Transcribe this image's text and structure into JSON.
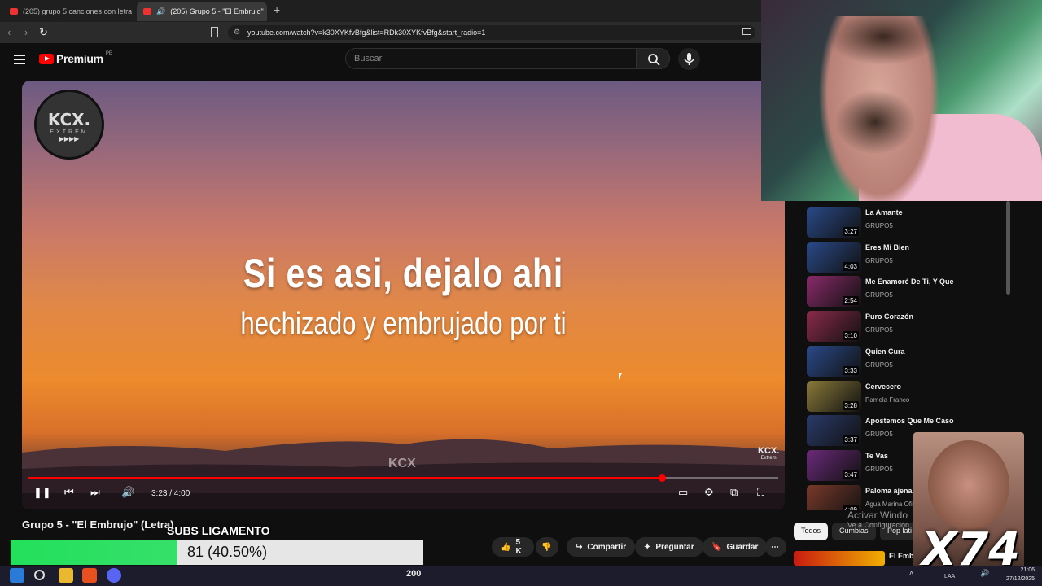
{
  "browser": {
    "tabs": [
      {
        "label": "(205) grupo 5 canciones con letra - Y"
      },
      {
        "label": "(205) Grupo 5 - \"El Embrujo\"",
        "active": true
      }
    ],
    "url": "youtube.com/watch?v=k30XYKfvBfg&list=RDk30XYKfvBfg&start_radio=1"
  },
  "youtube": {
    "logo": "Premium",
    "logo_region": "PE",
    "search_placeholder": "Buscar"
  },
  "player": {
    "lyric_line1": "Si es asi, dejalo ahi",
    "lyric_line2": "hechizado y embrujado por ti",
    "channel_logo_text": "KCX.",
    "channel_logo_sub": "EXTREM",
    "channel_logo_dots": "▶▶▶▶",
    "watermark": "KCX.",
    "watermark_sub": "Extrem",
    "center_watermark": "KCX",
    "time": "3:23 / 4:00",
    "progress": 0.845
  },
  "video": {
    "title": "Grupo 5 - \"El Embrujo\" (Letra)",
    "likes": "5 K",
    "share_label": "Compartir",
    "ask_label": "Preguntar",
    "save_label": "Guardar"
  },
  "sidebar": {
    "items": [
      {
        "title": "La Amante",
        "channel": "GRUPO5",
        "duration": "3:27",
        "thumb_color": "#2a4a8a"
      },
      {
        "title": "Eres Mi Bien",
        "channel": "GRUPO5",
        "duration": "4:03",
        "thumb_color": "#2a4a8a"
      },
      {
        "title": "Me Enamoré De Ti, Y Que",
        "channel": "GRUPO5",
        "duration": "2:54",
        "thumb_color": "#8a2a6a"
      },
      {
        "title": "Puro Corazón",
        "channel": "GRUPO5",
        "duration": "3:10",
        "thumb_color": "#8a2a4a"
      },
      {
        "title": "Quien Cura",
        "channel": "GRUPO5",
        "duration": "3:33",
        "thumb_color": "#2a4a8a"
      },
      {
        "title": "Cervecero",
        "channel": "Pamela Franco",
        "duration": "3:28",
        "thumb_color": "#8a7a3a"
      },
      {
        "title": "Apostemos Que Me Caso",
        "channel": "GRUPO5",
        "duration": "3:37",
        "thumb_color": "#2a3a6a"
      },
      {
        "title": "Te Vas",
        "channel": "GRUPO5",
        "duration": "3:47",
        "thumb_color": "#6a2a7a"
      },
      {
        "title": "Paloma ajena",
        "channel": "Agua Marina Ofi",
        "duration": "4:09",
        "thumb_color": "#7a3a2a"
      }
    ],
    "chips": [
      "Todos",
      "Cumbias",
      "Pop lati"
    ],
    "next_title": "El Embrujo"
  },
  "overlay": {
    "subs_label": "SUBS LIGAMENTO",
    "subs_text": "81 (40.50%)",
    "subs_fraction": 0.405,
    "meme_text": "X74"
  },
  "windows": {
    "activate_text": "Activar Windo",
    "activate_sub": "Ve a Configuración",
    "taskbar_number": "200",
    "lang": "LAA",
    "time": "21:06",
    "date": "27/12/2025"
  }
}
